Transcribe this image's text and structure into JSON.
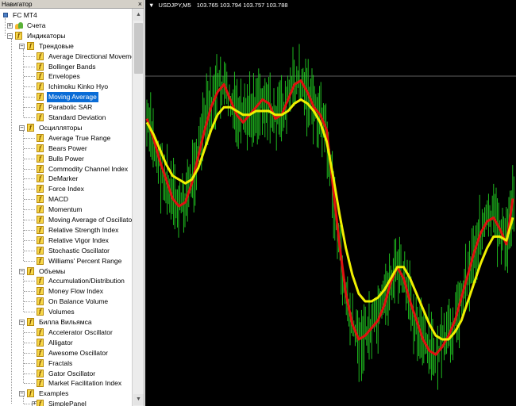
{
  "navigator": {
    "title": "Навигатор",
    "close": "×",
    "items": [
      {
        "label": "FC MT4",
        "level": 0,
        "type": "terminal",
        "toggle": ""
      },
      {
        "label": "Счета",
        "level": 1,
        "type": "accounts",
        "toggle": "+"
      },
      {
        "label": "Индикаторы",
        "level": 1,
        "type": "folder",
        "toggle": "-"
      },
      {
        "label": "Трендовые",
        "level": 2,
        "type": "folder",
        "toggle": "-"
      },
      {
        "label": "Average Directional Movement Index",
        "level": 3,
        "type": "indicator"
      },
      {
        "label": "Bollinger Bands",
        "level": 3,
        "type": "indicator"
      },
      {
        "label": "Envelopes",
        "level": 3,
        "type": "indicator"
      },
      {
        "label": "Ichimoku Kinko Hyo",
        "level": 3,
        "type": "indicator"
      },
      {
        "label": "Moving Average",
        "level": 3,
        "type": "indicator",
        "selected": true
      },
      {
        "label": "Parabolic SAR",
        "level": 3,
        "type": "indicator"
      },
      {
        "label": "Standard Deviation",
        "level": 3,
        "type": "indicator"
      },
      {
        "label": "Осцилляторы",
        "level": 2,
        "type": "folder",
        "toggle": "-"
      },
      {
        "label": "Average True Range",
        "level": 3,
        "type": "indicator"
      },
      {
        "label": "Bears Power",
        "level": 3,
        "type": "indicator"
      },
      {
        "label": "Bulls Power",
        "level": 3,
        "type": "indicator"
      },
      {
        "label": "Commodity Channel Index",
        "level": 3,
        "type": "indicator"
      },
      {
        "label": "DeMarker",
        "level": 3,
        "type": "indicator"
      },
      {
        "label": "Force Index",
        "level": 3,
        "type": "indicator"
      },
      {
        "label": "MACD",
        "level": 3,
        "type": "indicator"
      },
      {
        "label": "Momentum",
        "level": 3,
        "type": "indicator"
      },
      {
        "label": "Moving Average of Oscillator",
        "level": 3,
        "type": "indicator"
      },
      {
        "label": "Relative Strength Index",
        "level": 3,
        "type": "indicator"
      },
      {
        "label": "Relative Vigor Index",
        "level": 3,
        "type": "indicator"
      },
      {
        "label": "Stochastic Oscillator",
        "level": 3,
        "type": "indicator"
      },
      {
        "label": "Williams' Percent Range",
        "level": 3,
        "type": "indicator"
      },
      {
        "label": "Объемы",
        "level": 2,
        "type": "folder",
        "toggle": "-"
      },
      {
        "label": "Accumulation/Distribution",
        "level": 3,
        "type": "indicator"
      },
      {
        "label": "Money Flow Index",
        "level": 3,
        "type": "indicator"
      },
      {
        "label": "On Balance Volume",
        "level": 3,
        "type": "indicator"
      },
      {
        "label": "Volumes",
        "level": 3,
        "type": "indicator"
      },
      {
        "label": "Билла Вильямса",
        "level": 2,
        "type": "folder",
        "toggle": "-"
      },
      {
        "label": "Accelerator Oscillator",
        "level": 3,
        "type": "indicator"
      },
      {
        "label": "Alligator",
        "level": 3,
        "type": "indicator"
      },
      {
        "label": "Awesome Oscillator",
        "level": 3,
        "type": "indicator"
      },
      {
        "label": "Fractals",
        "level": 3,
        "type": "indicator"
      },
      {
        "label": "Gator Oscillator",
        "level": 3,
        "type": "indicator"
      },
      {
        "label": "Market Facilitation Index",
        "level": 3,
        "type": "indicator"
      },
      {
        "label": "Examples",
        "level": 2,
        "type": "folder",
        "toggle": "-"
      },
      {
        "label": "SimplePanel",
        "level": 3,
        "type": "indicator",
        "toggle": "+"
      }
    ]
  },
  "chart": {
    "symbol": "USDJPY,M5",
    "ohlc": [
      "103.765",
      "103.794",
      "103.757",
      "103.788"
    ],
    "colors": {
      "background": "#000000",
      "candles": "#22cc22",
      "ma_fast": "#e01010",
      "ma_slow": "#f0f000",
      "level_line": "#606060"
    },
    "chart_data": {
      "type": "line",
      "ylim": [
        0,
        1
      ],
      "grid": false,
      "level_line": 0.78,
      "series": [
        {
          "color": "#e01010",
          "values": [
            0.73,
            0.68,
            0.62,
            0.57,
            0.52,
            0.5,
            0.51,
            0.56,
            0.63,
            0.7,
            0.76,
            0.8,
            0.82,
            0.78,
            0.74,
            0.72,
            0.74,
            0.76,
            0.78,
            0.77,
            0.73,
            0.74,
            0.78,
            0.82,
            0.83,
            0.8,
            0.76,
            0.74,
            0.7,
            0.55,
            0.4,
            0.27,
            0.19,
            0.15,
            0.16,
            0.18,
            0.2,
            0.24,
            0.3,
            0.34,
            0.31,
            0.25,
            0.2,
            0.15,
            0.12,
            0.11,
            0.13,
            0.16,
            0.2,
            0.26,
            0.32,
            0.38,
            0.43,
            0.46,
            0.47,
            0.44,
            0.4,
            0.52
          ]
        },
        {
          "color": "#f0f000",
          "values": [
            0.72,
            0.69,
            0.65,
            0.61,
            0.58,
            0.57,
            0.56,
            0.57,
            0.6,
            0.65,
            0.7,
            0.74,
            0.76,
            0.76,
            0.75,
            0.74,
            0.74,
            0.75,
            0.75,
            0.75,
            0.74,
            0.74,
            0.75,
            0.77,
            0.78,
            0.77,
            0.75,
            0.72,
            0.67,
            0.58,
            0.48,
            0.39,
            0.32,
            0.27,
            0.25,
            0.25,
            0.26,
            0.28,
            0.31,
            0.34,
            0.34,
            0.31,
            0.27,
            0.23,
            0.19,
            0.16,
            0.15,
            0.15,
            0.17,
            0.2,
            0.25,
            0.3,
            0.35,
            0.39,
            0.42,
            0.42,
            0.41,
            0.47
          ]
        }
      ]
    }
  }
}
